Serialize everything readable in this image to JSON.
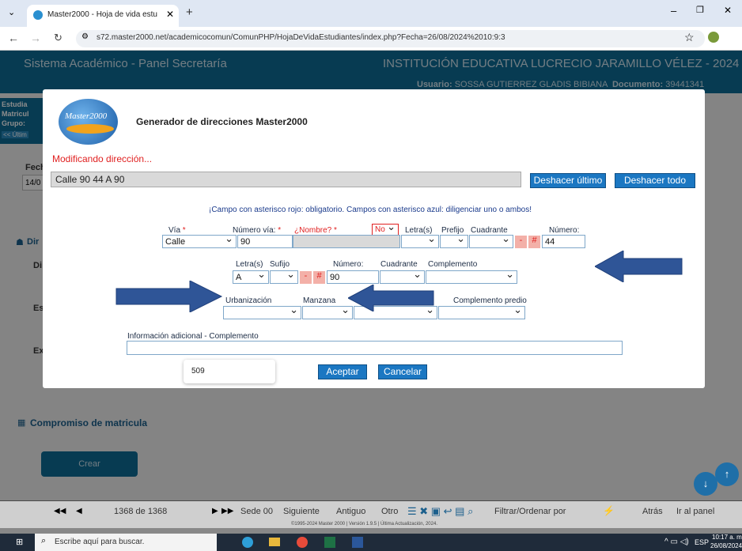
{
  "browser": {
    "tab_title": "Master2000 - Hoja de vida estu",
    "url": "s72.master2000.net/academicocomun/ComunPHP/HojaDeVidaEstudiantes/index.php?Fecha=26/08/2024%2010:9:3"
  },
  "app": {
    "left_title": "Sistema Académico - Panel Secretaría",
    "right_title": "INSTITUCIÓN EDUCATIVA LUCRECIO JARAMILLO VÉLEZ - 2024",
    "user_label": "Usuario:",
    "user": "SOSSA GUTIERREZ GLADIS BIBIANA",
    "doc_label": "Documento:",
    "doc": "39441341"
  },
  "left_info": {
    "line1": "Estudia",
    "line2": "Matricul",
    "line3": "Grupo:",
    "back": "<< Últim"
  },
  "page": {
    "fech": "Fech",
    "date_partial": "14/0",
    "dir": "Dir",
    "di": "Di",
    "es": "Es",
    "ex": "Ex",
    "compromiso": "Compromiso de matricula",
    "crear": "Crear"
  },
  "modal": {
    "logo_text": "Master2000",
    "title": "Generador de direcciones Master2000",
    "status": "Modificando dirección...",
    "address": "Calle 90 44 A 90",
    "undo_last": "Deshacer último",
    "undo_all": "Deshacer todo",
    "notice": "¡Campo con asterisco rojo: obligatorio. Campos con asterisco azul: diligenciar uno o ambos!",
    "via_label": "Vía",
    "num_via_label": "Número vía:",
    "nombre_label": "¿Nombre?",
    "letras_label": "Letra(s)",
    "prefijo_label": "Prefijo",
    "cuadrante_label": "Cuadrante",
    "numero_label": "Número:",
    "via_value": "Calle",
    "num_via_value": "90",
    "no_value": "No",
    "numero_value": "44",
    "letras2_label": "Letra(s)",
    "sufijo_label": "Sufijo",
    "numero2_label": "Número:",
    "cuadrante2_label": "Cuadrante",
    "complemento_label": "Complemento",
    "letras2_value": "A",
    "numero2_value": "90",
    "urbanizacion_label": "Urbanización",
    "manzana_label": "Manzana",
    "complemento_predio_label": "Complemento predio",
    "info_label": "Información adicional - Complemento",
    "count": "509",
    "accept": "Aceptar",
    "cancel": "Cancelar",
    "dash": "-",
    "hash": "#",
    "asterisk": "*"
  },
  "bottom": {
    "pager": "1368 de 1368",
    "sede": "Sede 00",
    "siguiente": "Siguiente",
    "antiguo": "Antiguo",
    "otro": "Otro",
    "filtrar": "Filtrar/Ordenar por",
    "atras": "Atrás",
    "ir": "Ir al panel",
    "footer": "©1995-2024 Master 2000 | Versión 1.9.5 | Última Actualización, 2024."
  },
  "taskbar": {
    "search": "Escribe aquí para buscar.",
    "lang": "ESP",
    "time": "10:17 a. m.",
    "date": "26/08/2024"
  },
  "colors": {
    "accent": "#1b77c2",
    "header": "#0e6c95",
    "required": "#e02020",
    "arrow": "#2f5597"
  }
}
